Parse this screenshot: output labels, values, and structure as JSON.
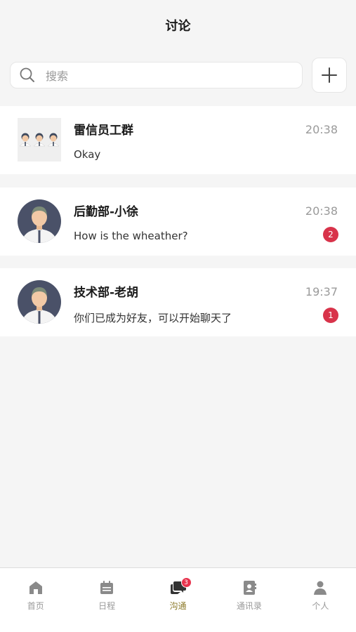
{
  "header": {
    "title": "讨论"
  },
  "search": {
    "placeholder": "搜索"
  },
  "conversations": [
    {
      "name": "雷信员工群",
      "preview": "Okay",
      "time": "20:38",
      "unread": ""
    },
    {
      "name": "后勤部-小徐",
      "preview": "How is the wheather?",
      "time": "20:38",
      "unread": "2"
    },
    {
      "name": "技术部-老胡",
      "preview": "你们已成为好友，可以开始聊天了",
      "time": "19:37",
      "unread": "1"
    }
  ],
  "tabs": [
    {
      "label": "首页",
      "icon": "home-icon"
    },
    {
      "label": "日程",
      "icon": "calendar-icon"
    },
    {
      "label": "沟通",
      "icon": "chat-icon",
      "badge": "3"
    },
    {
      "label": "通讯录",
      "icon": "contacts-icon"
    },
    {
      "label": "个人",
      "icon": "person-icon"
    }
  ],
  "colors": {
    "accent_active": "#8c7a2a",
    "badge": "#d8334a",
    "background": "#f5f5f5"
  }
}
